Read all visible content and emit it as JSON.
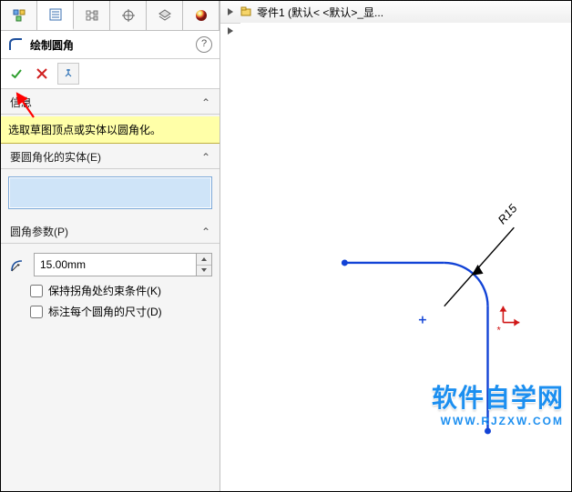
{
  "tabs": {
    "count": 6,
    "activeIndex": 1
  },
  "command": {
    "title": "绘制圆角",
    "help": "?"
  },
  "actions": {
    "ok_title": "确定",
    "cancel_title": "取消",
    "pin_title": "保持可见"
  },
  "info": {
    "head": "信息",
    "hint": "选取草图顶点或实体以圆角化。"
  },
  "entities": {
    "head": "要圆角化的实体(E)"
  },
  "params": {
    "head": "圆角参数(P)",
    "radius_value": "15.00mm",
    "keep_constraints_label": "保持拐角处约束条件(K)",
    "dimension_each_label": "标注每个圆角的尺寸(D)"
  },
  "tree": {
    "label": "零件1  (默认< <默认>_显..."
  },
  "sketch": {
    "dim_label": "R15"
  },
  "watermark": {
    "line1": "软件自学网",
    "line2": "WWW.RJZXW.COM"
  },
  "chevron": "⌃"
}
